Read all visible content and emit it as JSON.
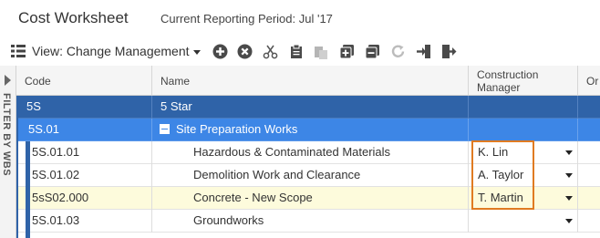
{
  "header": {
    "title": "Cost Worksheet",
    "period": "Current Reporting Period: Jul '17"
  },
  "toolbar": {
    "view_label": "View: Change Management",
    "icons": [
      "grid-menu-icon",
      "add-icon",
      "remove-icon",
      "cut-icon",
      "copy-icon",
      "paste-icon",
      "expand-all-icon",
      "collapse-all-icon",
      "refresh-icon",
      "import-icon",
      "export-icon"
    ]
  },
  "filter": {
    "label": "FILTER BY WBS"
  },
  "columns": {
    "code": "Code",
    "name": "Name",
    "construction_manager_line1": "Construction",
    "construction_manager_line2": "Manager",
    "or": "Or"
  },
  "rows": [
    {
      "code": "5S",
      "name": "5 Star",
      "manager": ""
    },
    {
      "code": "5S.01",
      "name": "Site Preparation Works",
      "manager": ""
    },
    {
      "code": "5S.01.01",
      "name": "Hazardous & Contaminated Materials",
      "manager": "K. Lin"
    },
    {
      "code": "5S.01.02",
      "name": "Demolition Work and Clearance",
      "manager": "A. Taylor"
    },
    {
      "code": "5sS02.000",
      "name": "Concrete - New Scope",
      "manager": "T. Martin"
    },
    {
      "code": "5S.01.03",
      "name": "Groundworks",
      "manager": ""
    }
  ],
  "colors": {
    "level0": "#2f63a8",
    "level1": "#3d86e6",
    "highlight_row": "#fdfbdc",
    "edit_outline": "#e07b22"
  }
}
